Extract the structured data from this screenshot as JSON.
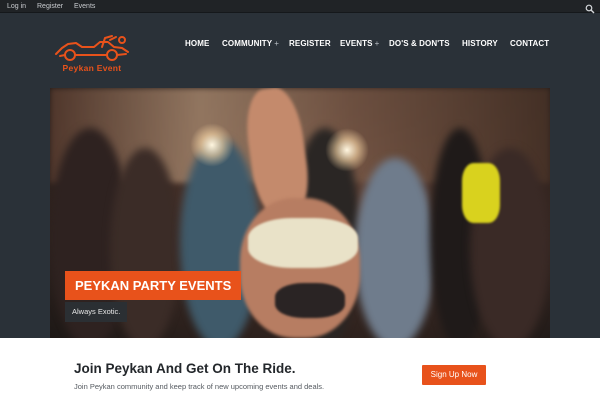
{
  "topbar": {
    "links": [
      "Log in",
      "Register",
      "Events"
    ],
    "search_icon": "search-icon"
  },
  "logo": {
    "text": "Peykan Event",
    "color": "#e8521b"
  },
  "nav": {
    "items": [
      {
        "label": "HOME",
        "has_submenu": false
      },
      {
        "label": "COMMUNITY",
        "has_submenu": true
      },
      {
        "label": "REGISTER",
        "has_submenu": false
      },
      {
        "label": "EVENTS",
        "has_submenu": true
      },
      {
        "label": "DO'S & DON'TS",
        "has_submenu": false
      },
      {
        "label": "HISTORY",
        "has_submenu": false
      },
      {
        "label": "CONTACT",
        "has_submenu": false
      }
    ],
    "submenu_marker": "+"
  },
  "hero": {
    "title": "PEYKAN PARTY EVENTS",
    "subtitle": "Always Exotic."
  },
  "cta": {
    "title": "Join Peykan And Get On The Ride.",
    "text": "Join Peykan community and keep track of new upcoming events and deals.",
    "button_label": "Sign Up Now"
  },
  "colors": {
    "accent": "#e8521b",
    "header_bg": "#2a3138",
    "topbar_bg": "#202326",
    "band_bg": "#ffffff"
  }
}
